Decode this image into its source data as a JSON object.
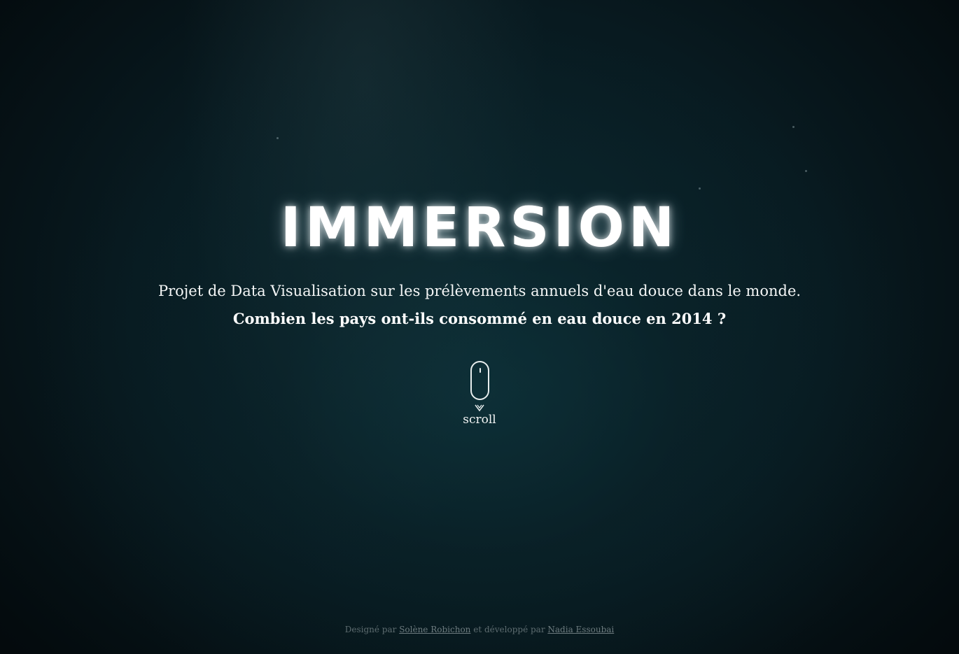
{
  "hero": {
    "title": "IMMERSION",
    "subtitle": "Projet de Data Visualisation sur les prélèvements annuels d'eau douce dans le monde.",
    "question": "Combien les pays ont-ils consommé en eau douce en 2014 ?"
  },
  "scroll_hint": {
    "icon": "mouse-icon",
    "arrow_icon": "chevron-down-icon",
    "label": "scroll"
  },
  "footer": {
    "prefix": "Designé par",
    "designer": "Solène Robichon",
    "middle": "et développé par",
    "developer": "Nadia Essoubai"
  },
  "colors": {
    "background_center": "#0c262d",
    "background_edge": "#020608",
    "text": "#f2f4f4",
    "footer_text": "#5e6c70"
  }
}
